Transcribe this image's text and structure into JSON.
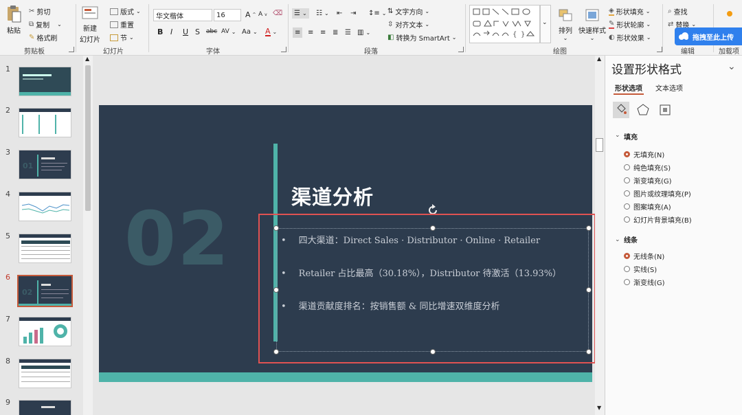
{
  "ribbon": {
    "clipboard": {
      "paste": "粘贴",
      "cut": "剪切",
      "copy": "复制",
      "format_painter": "格式刷",
      "label": "剪贴板"
    },
    "slides": {
      "new_slide": "新建",
      "new_slide2": "幻灯片",
      "layout": "版式",
      "reset": "重置",
      "section": "节",
      "label": "幻灯片"
    },
    "font": {
      "font_name": "华文楷体",
      "font_size": "16",
      "bold": "B",
      "italic": "I",
      "underline": "U",
      "shadow": "S",
      "strike": "abc",
      "spacing": "AV",
      "case": "Aa",
      "color": "A",
      "grow": "A",
      "shrink": "A",
      "label": "字体"
    },
    "paragraph": {
      "text_direction": "文字方向",
      "align_text": "对齐文本",
      "smartart": "转换为 SmartArt",
      "label": "段落"
    },
    "drawing": {
      "arrange": "排列",
      "quick_styles": "快速样式",
      "shape_fill": "形状填充",
      "shape_outline": "形状轮廓",
      "shape_effects": "形状效果",
      "label": "绘图"
    },
    "editing": {
      "find": "查找",
      "replace": "替换",
      "label": "编辑"
    },
    "addins": {
      "label": "加载项"
    },
    "overlay": {
      "text": "拖拽至此上传"
    }
  },
  "thumbnails": [
    {
      "num": "1"
    },
    {
      "num": "2"
    },
    {
      "num": "3"
    },
    {
      "num": "4"
    },
    {
      "num": "5"
    },
    {
      "num": "6",
      "active": true
    },
    {
      "num": "7"
    },
    {
      "num": "8"
    },
    {
      "num": "9"
    }
  ],
  "slide": {
    "number": "02",
    "title": "渠道分析",
    "bullets": [
      "四大渠道：Direct Sales · Distributor · Online · Retailer",
      "Retailer 占比最高（30.18%），Distributor 待激活（13.93%）",
      "渠道贡献度排名：按销售额 & 同比增速双维度分析"
    ],
    "colors": {
      "background": "#2d3c4e",
      "accent": "#4fb3a9",
      "number": "#3b5b66",
      "selection": "#e05252"
    }
  },
  "panel": {
    "title": "设置形状格式",
    "tab_shape": "形状选项",
    "tab_text": "文本选项",
    "fill_section": "填充",
    "fill_options": [
      "无填充(N)",
      "纯色填充(S)",
      "渐变填充(G)",
      "图片或纹理填充(P)",
      "图案填充(A)",
      "幻灯片背景填充(B)"
    ],
    "line_section": "线条",
    "line_options": [
      "无线条(N)",
      "实线(S)",
      "渐变线(G)"
    ]
  }
}
